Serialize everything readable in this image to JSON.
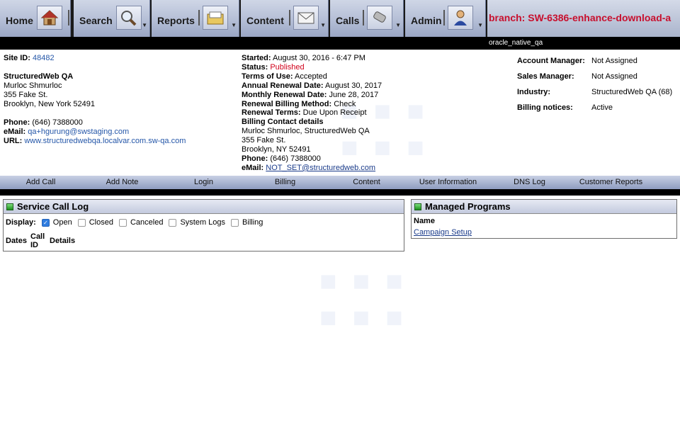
{
  "nav": {
    "items": [
      {
        "label": "Home",
        "icon": "home-icon"
      },
      {
        "label": "Search",
        "icon": "magnifier-icon"
      },
      {
        "label": "Reports",
        "icon": "folder-icon"
      },
      {
        "label": "Content",
        "icon": "envelope-icon"
      },
      {
        "label": "Calls",
        "icon": "phone-icon"
      },
      {
        "label": "Admin",
        "icon": "user-icon"
      }
    ],
    "branch": "branch: SW-6386-enhance-download-a",
    "environment": "oracle_native_qa"
  },
  "account": {
    "site_id_label": "Site ID:",
    "site_id": "48482",
    "company": "StructuredWeb QA",
    "contact": "Murloc Shmurloc",
    "street": "355 Fake St.",
    "city": "Brooklyn, New York 52491",
    "phone_label": "Phone:",
    "phone": "(646) 7388000",
    "email_label": "eMail:",
    "email": "qa+hgurung@swstaging.com",
    "url_label": "URL:",
    "url": "www.structuredwebqa.localvar.com.sw-qa.com"
  },
  "status": {
    "started_label": "Started:",
    "started": "August 30, 2016 - 6:47 PM",
    "status_label": "Status:",
    "status": "Published",
    "terms_label": "Terms of Use:",
    "terms": "Accepted",
    "annual_label": "Annual Renewal Date:",
    "annual": "August 30, 2017",
    "monthly_label": "Monthly Renewal Date:",
    "monthly": "June 28, 2017",
    "method_label": "Renewal Billing Method:",
    "method": "Check",
    "rterms_label": "Renewal Terms:",
    "rterms": "Due Upon Receipt",
    "billing_contact_label": "Billing Contact details",
    "billing_name": "Murloc Shmurloc, StructuredWeb QA",
    "billing_street": "355 Fake St.",
    "billing_city": "Brooklyn, NY 52491",
    "billing_phone_label": "Phone:",
    "billing_phone": "(646) 7388000",
    "billing_email_label": "eMail:",
    "billing_email": "NOT_SET@structuredweb.com"
  },
  "managers": [
    {
      "key": "Account Manager:",
      "value": "Not Assigned"
    },
    {
      "key": "Sales Manager:",
      "value": "Not Assigned"
    },
    {
      "key": "Industry:",
      "value": "StructuredWeb QA (68)"
    },
    {
      "key": "Billing notices:",
      "value": "Active"
    }
  ],
  "actions": [
    "Add Call",
    "Add Note",
    "Login",
    "Billing",
    "Content",
    "User Information",
    "DNS Log",
    "Customer Reports"
  ],
  "service_log": {
    "title": "Service Call Log",
    "display_label": "Display:",
    "filters": [
      {
        "label": "Open",
        "checked": true
      },
      {
        "label": "Closed",
        "checked": false
      },
      {
        "label": "Canceled",
        "checked": false
      },
      {
        "label": "System Logs",
        "checked": false
      },
      {
        "label": "Billing",
        "checked": false
      }
    ],
    "columns": [
      "Dates",
      "Call ID",
      "Details"
    ]
  },
  "managed_programs": {
    "title": "Managed Programs",
    "column": "Name",
    "items": [
      "Campaign Setup"
    ]
  },
  "colors": {
    "accent": "#2456a8",
    "status_red": "#d0021b",
    "branch_red": "#c8102e"
  }
}
